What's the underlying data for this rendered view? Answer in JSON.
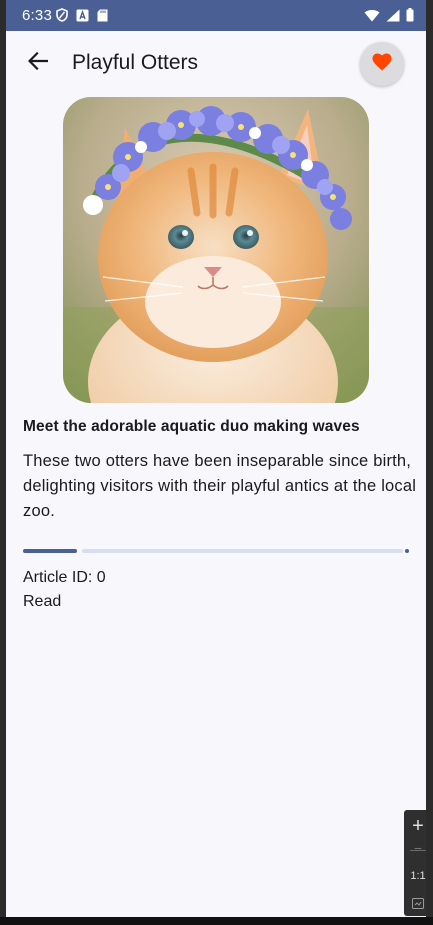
{
  "status_bar": {
    "time": "6:33",
    "left_icons": [
      "shield-icon",
      "a-badge-icon",
      "sd-card-icon"
    ],
    "right_icons": [
      "wifi-icon",
      "signal-icon",
      "battery-icon"
    ],
    "background": "#4a5f94"
  },
  "top_bar": {
    "title": "Playful Otters",
    "back_icon": "arrow-left-icon",
    "favorite_icon": "heart-icon",
    "favorite_active": true,
    "favorite_color": "#ff4500"
  },
  "article": {
    "image_subject": "orange kitten wearing a blue flower crown",
    "headline": "Meet the adorable aquatic duo making waves",
    "body": "These two otters have been inseparable since birth, delighting visitors with their playful antics at the local zoo.",
    "progress": 0.14,
    "id_label": "Article ID: 0",
    "status": "Read"
  },
  "zoom_controls": {
    "zoom_in": "+",
    "zoom_out": "−",
    "actual_size": "1:1",
    "fit_icon": "fit-screen-icon"
  },
  "colors": {
    "accent": "#4a5f94",
    "track": "#d7deef",
    "surface": "#f8f7fc"
  }
}
